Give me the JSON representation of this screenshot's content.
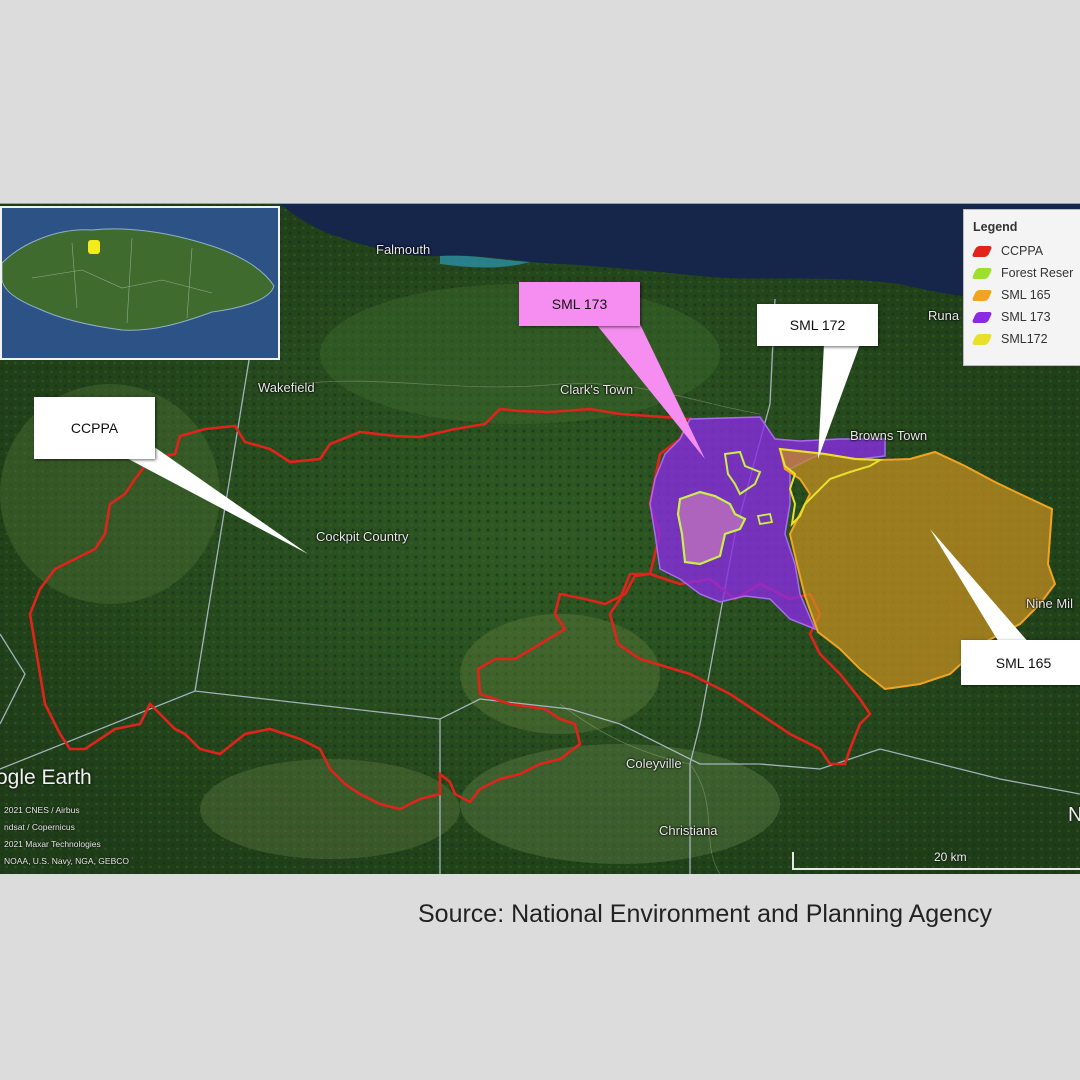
{
  "places": {
    "falmouth": "Falmouth",
    "wakefield": "Wakefield",
    "clarks_town": "Clark's Town",
    "browns_town": "Browns Town",
    "runaway": "Runa",
    "cockpit_country": "Cockpit Country",
    "nine_mile": "Nine Mil",
    "coleyville": "Coleyville",
    "christiana": "Christiana"
  },
  "callouts": {
    "ccppa": "CCPPA",
    "sml173": "SML 173",
    "sml172": "SML 172",
    "sml165": "SML 165"
  },
  "legend": {
    "title": "Legend",
    "items": [
      {
        "label": "CCPPA",
        "color": "#e0241c"
      },
      {
        "label": "Forest Reser",
        "color": "#9be02a"
      },
      {
        "label": "SML 165",
        "color": "#f0a422"
      },
      {
        "label": "SML 173",
        "color": "#8a2be2"
      },
      {
        "label": "SML172",
        "color": "#e8e02a"
      }
    ]
  },
  "branding": {
    "logo": "ogle Earth",
    "attributions": [
      "2021 CNES / Airbus",
      "ndsat / Copernicus",
      "2021 Maxar Technologies",
      "NOAA, U.S. Navy, NGA, GEBCO"
    ]
  },
  "scale_label": "20 km",
  "north_label": "N",
  "source": "Source: National Environment and Planning Agency",
  "colors": {
    "ccppa": "#e0241c",
    "sml173": "#8a2be2",
    "sml165": "#e0a020",
    "sml172": "#e8e02a",
    "forest_reserve": "#9be02a",
    "callout_sml173": "#f58ef0"
  }
}
